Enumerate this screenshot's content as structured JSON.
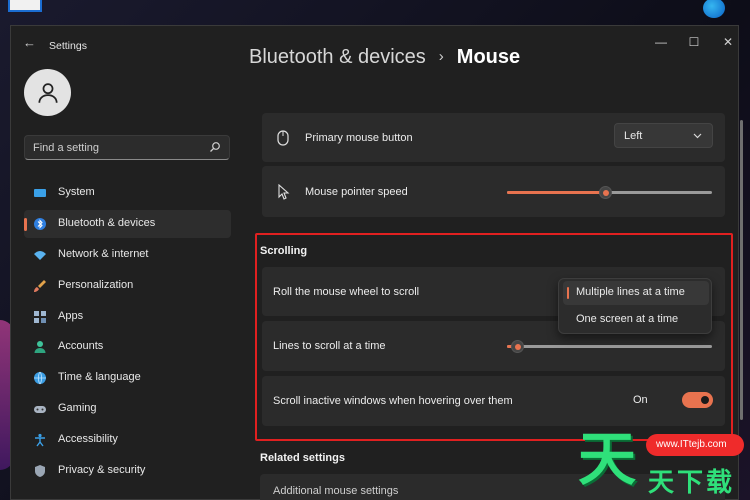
{
  "window": {
    "app_title": "Settings",
    "back_glyph": "←",
    "minimize_glyph": "—",
    "maximize_glyph": "☐",
    "close_glyph": "✕"
  },
  "search": {
    "placeholder": "Find a setting"
  },
  "sidebar": {
    "items": [
      {
        "label": "System",
        "icon": "monitor-icon",
        "active": false
      },
      {
        "label": "Bluetooth & devices",
        "icon": "bluetooth-icon",
        "active": true
      },
      {
        "label": "Network & internet",
        "icon": "wifi-icon",
        "active": false
      },
      {
        "label": "Personalization",
        "icon": "brush-icon",
        "active": false
      },
      {
        "label": "Apps",
        "icon": "apps-icon",
        "active": false
      },
      {
        "label": "Accounts",
        "icon": "person-icon",
        "active": false
      },
      {
        "label": "Time & language",
        "icon": "globe-clock-icon",
        "active": false
      },
      {
        "label": "Gaming",
        "icon": "gamepad-icon",
        "active": false
      },
      {
        "label": "Accessibility",
        "icon": "accessibility-icon",
        "active": false
      },
      {
        "label": "Privacy & security",
        "icon": "shield-icon",
        "active": false
      }
    ]
  },
  "breadcrumb": {
    "parent": "Bluetooth & devices",
    "separator": "›",
    "current": "Mouse"
  },
  "mouse": {
    "primary_button": {
      "label": "Primary mouse button",
      "value": "Left"
    },
    "pointer_speed": {
      "label": "Mouse pointer speed",
      "value_fraction": 0.48
    }
  },
  "scrolling": {
    "title": "Scrolling",
    "roll_wheel": {
      "label": "Roll the mouse wheel to scroll",
      "options": [
        "Multiple lines at a time",
        "One screen at a time"
      ],
      "selected": "Multiple lines at a time"
    },
    "lines_to_scroll": {
      "label": "Lines to scroll at a time",
      "value_fraction": 0.05
    },
    "inactive_scroll": {
      "label": "Scroll inactive windows when hovering over them",
      "state": "On"
    }
  },
  "related": {
    "title": "Related settings",
    "first_item": "Additional mouse settings"
  },
  "watermark": {
    "big": "天",
    "pill": "www.ITtejb.com",
    "small": "天下载"
  },
  "colors": {
    "accent": "#e8734f",
    "highlight_box": "#e02020",
    "watermark_green": "#2fe07a",
    "watermark_red": "#ef2b2b"
  }
}
